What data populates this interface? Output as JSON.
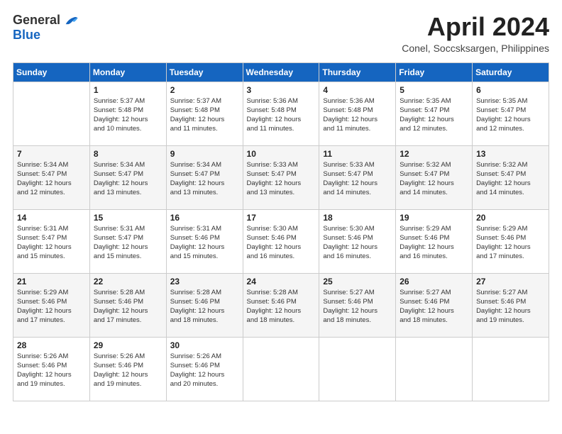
{
  "logo": {
    "general": "General",
    "blue": "Blue"
  },
  "title": "April 2024",
  "location": "Conel, Soccsksargen, Philippines",
  "headers": [
    "Sunday",
    "Monday",
    "Tuesday",
    "Wednesday",
    "Thursday",
    "Friday",
    "Saturday"
  ],
  "weeks": [
    [
      {
        "day": "",
        "info": ""
      },
      {
        "day": "1",
        "info": "Sunrise: 5:37 AM\nSunset: 5:48 PM\nDaylight: 12 hours\nand 10 minutes."
      },
      {
        "day": "2",
        "info": "Sunrise: 5:37 AM\nSunset: 5:48 PM\nDaylight: 12 hours\nand 11 minutes."
      },
      {
        "day": "3",
        "info": "Sunrise: 5:36 AM\nSunset: 5:48 PM\nDaylight: 12 hours\nand 11 minutes."
      },
      {
        "day": "4",
        "info": "Sunrise: 5:36 AM\nSunset: 5:48 PM\nDaylight: 12 hours\nand 11 minutes."
      },
      {
        "day": "5",
        "info": "Sunrise: 5:35 AM\nSunset: 5:47 PM\nDaylight: 12 hours\nand 12 minutes."
      },
      {
        "day": "6",
        "info": "Sunrise: 5:35 AM\nSunset: 5:47 PM\nDaylight: 12 hours\nand 12 minutes."
      }
    ],
    [
      {
        "day": "7",
        "info": "Sunrise: 5:34 AM\nSunset: 5:47 PM\nDaylight: 12 hours\nand 12 minutes."
      },
      {
        "day": "8",
        "info": "Sunrise: 5:34 AM\nSunset: 5:47 PM\nDaylight: 12 hours\nand 13 minutes."
      },
      {
        "day": "9",
        "info": "Sunrise: 5:34 AM\nSunset: 5:47 PM\nDaylight: 12 hours\nand 13 minutes."
      },
      {
        "day": "10",
        "info": "Sunrise: 5:33 AM\nSunset: 5:47 PM\nDaylight: 12 hours\nand 13 minutes."
      },
      {
        "day": "11",
        "info": "Sunrise: 5:33 AM\nSunset: 5:47 PM\nDaylight: 12 hours\nand 14 minutes."
      },
      {
        "day": "12",
        "info": "Sunrise: 5:32 AM\nSunset: 5:47 PM\nDaylight: 12 hours\nand 14 minutes."
      },
      {
        "day": "13",
        "info": "Sunrise: 5:32 AM\nSunset: 5:47 PM\nDaylight: 12 hours\nand 14 minutes."
      }
    ],
    [
      {
        "day": "14",
        "info": "Sunrise: 5:31 AM\nSunset: 5:47 PM\nDaylight: 12 hours\nand 15 minutes."
      },
      {
        "day": "15",
        "info": "Sunrise: 5:31 AM\nSunset: 5:47 PM\nDaylight: 12 hours\nand 15 minutes."
      },
      {
        "day": "16",
        "info": "Sunrise: 5:31 AM\nSunset: 5:46 PM\nDaylight: 12 hours\nand 15 minutes."
      },
      {
        "day": "17",
        "info": "Sunrise: 5:30 AM\nSunset: 5:46 PM\nDaylight: 12 hours\nand 16 minutes."
      },
      {
        "day": "18",
        "info": "Sunrise: 5:30 AM\nSunset: 5:46 PM\nDaylight: 12 hours\nand 16 minutes."
      },
      {
        "day": "19",
        "info": "Sunrise: 5:29 AM\nSunset: 5:46 PM\nDaylight: 12 hours\nand 16 minutes."
      },
      {
        "day": "20",
        "info": "Sunrise: 5:29 AM\nSunset: 5:46 PM\nDaylight: 12 hours\nand 17 minutes."
      }
    ],
    [
      {
        "day": "21",
        "info": "Sunrise: 5:29 AM\nSunset: 5:46 PM\nDaylight: 12 hours\nand 17 minutes."
      },
      {
        "day": "22",
        "info": "Sunrise: 5:28 AM\nSunset: 5:46 PM\nDaylight: 12 hours\nand 17 minutes."
      },
      {
        "day": "23",
        "info": "Sunrise: 5:28 AM\nSunset: 5:46 PM\nDaylight: 12 hours\nand 18 minutes."
      },
      {
        "day": "24",
        "info": "Sunrise: 5:28 AM\nSunset: 5:46 PM\nDaylight: 12 hours\nand 18 minutes."
      },
      {
        "day": "25",
        "info": "Sunrise: 5:27 AM\nSunset: 5:46 PM\nDaylight: 12 hours\nand 18 minutes."
      },
      {
        "day": "26",
        "info": "Sunrise: 5:27 AM\nSunset: 5:46 PM\nDaylight: 12 hours\nand 18 minutes."
      },
      {
        "day": "27",
        "info": "Sunrise: 5:27 AM\nSunset: 5:46 PM\nDaylight: 12 hours\nand 19 minutes."
      }
    ],
    [
      {
        "day": "28",
        "info": "Sunrise: 5:26 AM\nSunset: 5:46 PM\nDaylight: 12 hours\nand 19 minutes."
      },
      {
        "day": "29",
        "info": "Sunrise: 5:26 AM\nSunset: 5:46 PM\nDaylight: 12 hours\nand 19 minutes."
      },
      {
        "day": "30",
        "info": "Sunrise: 5:26 AM\nSunset: 5:46 PM\nDaylight: 12 hours\nand 20 minutes."
      },
      {
        "day": "",
        "info": ""
      },
      {
        "day": "",
        "info": ""
      },
      {
        "day": "",
        "info": ""
      },
      {
        "day": "",
        "info": ""
      }
    ]
  ]
}
